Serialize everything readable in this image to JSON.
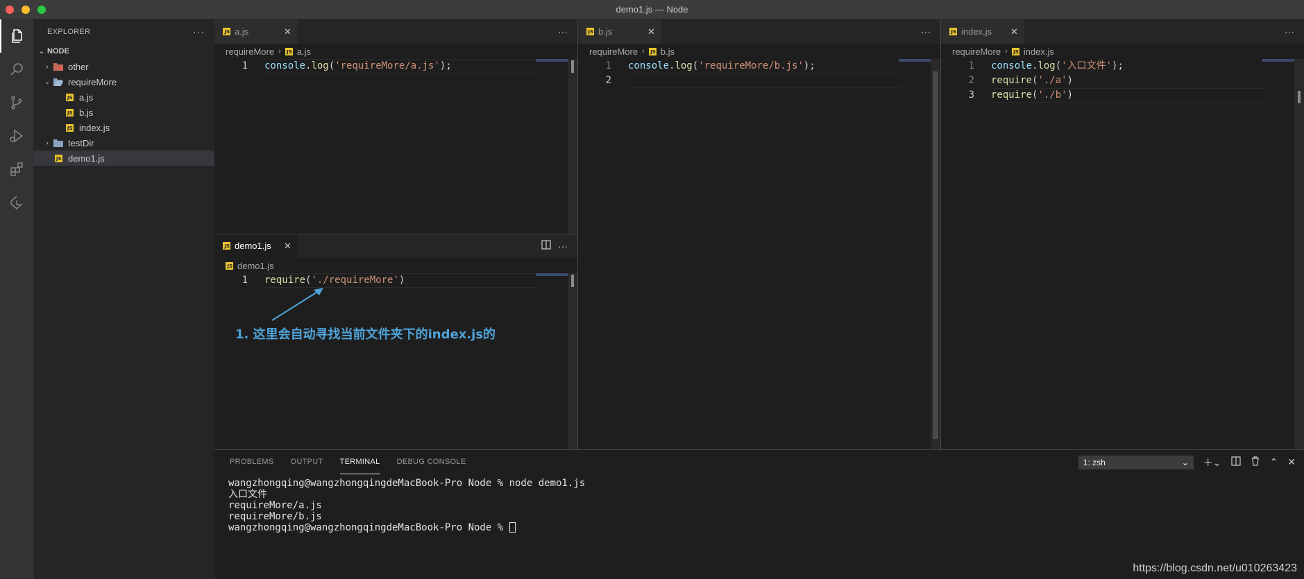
{
  "window": {
    "title": "demo1.js — Node"
  },
  "activity_bar": {
    "items": [
      {
        "name": "explorer-icon",
        "active": true
      },
      {
        "name": "search-icon"
      },
      {
        "name": "source-control-icon"
      },
      {
        "name": "run-debug-icon"
      },
      {
        "name": "extensions-icon"
      },
      {
        "name": "remote-icon"
      }
    ]
  },
  "sidebar": {
    "title": "EXPLORER",
    "more": "···",
    "root": "NODE",
    "items": [
      {
        "label": "other",
        "type": "folder",
        "depth": 1,
        "expanded": false
      },
      {
        "label": "requireMore",
        "type": "folder",
        "depth": 1,
        "expanded": true
      },
      {
        "label": "a.js",
        "type": "js",
        "depth": 2
      },
      {
        "label": "b.js",
        "type": "js",
        "depth": 2
      },
      {
        "label": "index.js",
        "type": "js",
        "depth": 2
      },
      {
        "label": "testDir",
        "type": "folder",
        "depth": 1,
        "expanded": false
      },
      {
        "label": "demo1.js",
        "type": "js",
        "depth": 1,
        "selected": true
      }
    ]
  },
  "editors": {
    "a": {
      "tab": "a.js",
      "breadcrumb": [
        "requireMore",
        "a.js"
      ],
      "lines": [
        {
          "n": "1",
          "tokens": [
            [
              "obj",
              "console"
            ],
            [
              "br",
              "."
            ],
            [
              "fn",
              "log"
            ],
            [
              "br",
              "("
            ],
            [
              "str",
              "'requireMore/a.js'"
            ],
            [
              "br",
              ");"
            ]
          ]
        }
      ]
    },
    "b": {
      "tab": "b.js",
      "breadcrumb": [
        "requireMore",
        "b.js"
      ],
      "lines": [
        {
          "n": "1",
          "tokens": [
            [
              "obj",
              "console"
            ],
            [
              "br",
              "."
            ],
            [
              "fn",
              "log"
            ],
            [
              "br",
              "("
            ],
            [
              "str",
              "'requireMore/b.js'"
            ],
            [
              "br",
              ");"
            ]
          ]
        },
        {
          "n": "2",
          "tokens": []
        }
      ]
    },
    "index": {
      "tab": "index.js",
      "breadcrumb": [
        "requireMore",
        "index.js"
      ],
      "lines": [
        {
          "n": "1",
          "tokens": [
            [
              "obj",
              "console"
            ],
            [
              "br",
              "."
            ],
            [
              "fn",
              "log"
            ],
            [
              "br",
              "("
            ],
            [
              "str",
              "'入口文件'"
            ],
            [
              "br",
              ");"
            ]
          ]
        },
        {
          "n": "2",
          "tokens": [
            [
              "fn",
              "require"
            ],
            [
              "br",
              "("
            ],
            [
              "str",
              "'./a'"
            ],
            [
              "br",
              ")"
            ]
          ]
        },
        {
          "n": "3",
          "tokens": [
            [
              "fn",
              "require"
            ],
            [
              "br",
              "("
            ],
            [
              "str",
              "'./b'"
            ],
            [
              "br",
              ")"
            ]
          ]
        }
      ]
    },
    "demo1": {
      "tab": "demo1.js",
      "breadcrumb": [
        "demo1.js"
      ],
      "lines": [
        {
          "n": "1",
          "tokens": [
            [
              "fn",
              "require"
            ],
            [
              "br",
              "("
            ],
            [
              "str",
              "'./requireMore'"
            ],
            [
              "br",
              ")"
            ]
          ]
        }
      ]
    }
  },
  "annotation": {
    "text": "1. 这里会自动寻找当前文件夹下的index.js的"
  },
  "panel": {
    "tabs": [
      "PROBLEMS",
      "OUTPUT",
      "TERMINAL",
      "DEBUG CONSOLE"
    ],
    "active_tab": "TERMINAL",
    "terminal_select": "1: zsh",
    "terminal_lines": [
      "wangzhongqing@wangzhongqingdeMacBook-Pro Node % node demo1.js",
      "入口文件",
      "requireMore/a.js",
      "requireMore/b.js",
      "wangzhongqing@wangzhongqingdeMacBook-Pro Node % "
    ]
  },
  "watermark": "https://blog.csdn.net/u010263423",
  "colors": {
    "js_badge": "#e8c32f",
    "annotation": "#4fa3d8",
    "string": "#ce9178",
    "function": "#dcdcaa",
    "variable": "#9cdcfe"
  }
}
